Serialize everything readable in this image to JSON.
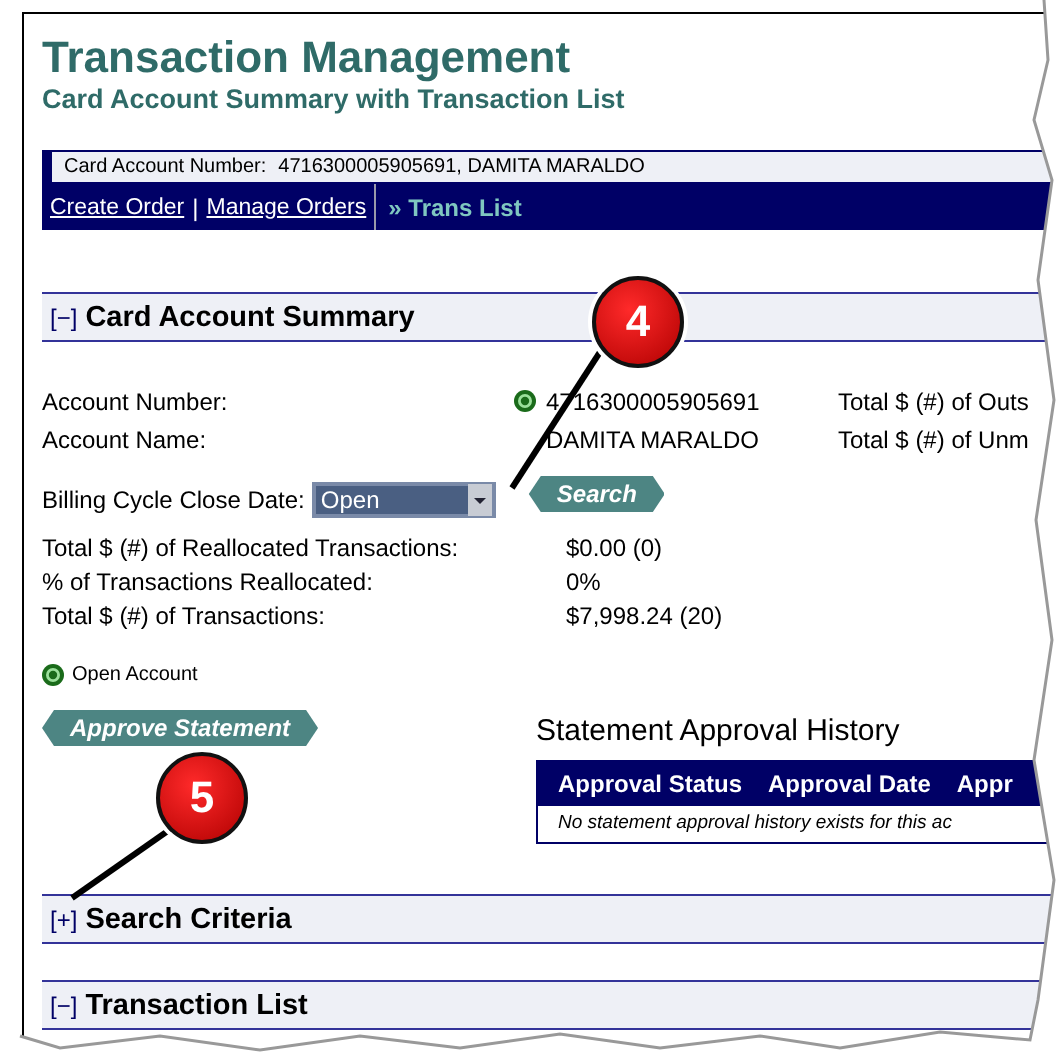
{
  "header": {
    "title": "Transaction Management",
    "subtitle": "Card Account Summary with Transaction List"
  },
  "account_bar": {
    "label": "Card Account Number:",
    "value": "4716300005905691, DAMITA MARALDO"
  },
  "nav": {
    "separator": "|",
    "links": [
      {
        "label": "Create Order"
      },
      {
        "label": "Manage Orders"
      }
    ],
    "current": "» Trans List"
  },
  "summary": {
    "toggle": "[−]",
    "title": "Card Account Summary",
    "fields": [
      {
        "label": "Account Number:",
        "value": "4716300005905691",
        "status_icon": true,
        "extra": "Total $ (#) of Outs"
      },
      {
        "label": "Account Name:",
        "value": "DAMITA MARALDO",
        "status_icon": false,
        "extra": "Total $ (#) of Unm"
      }
    ],
    "billing": {
      "label": "Billing Cycle Close Date:",
      "value": "Open",
      "button": "Search"
    },
    "totals": [
      {
        "label": "Total $ (#) of Reallocated Transactions:",
        "value": "$0.00 (0)"
      },
      {
        "label": "% of Transactions Reallocated:",
        "value": "0%"
      },
      {
        "label": "Total $ (#) of Transactions:",
        "value": "$7,998.24 (20)"
      }
    ],
    "legend": "Open Account",
    "approve_button": "Approve Statement",
    "history": {
      "title": "Statement Approval History",
      "columns": [
        "Approval Status",
        "Approval Date",
        "Appr"
      ],
      "empty": "No statement approval history exists for this ac"
    }
  },
  "sections": [
    {
      "toggle": "[+]",
      "title": "Search Criteria"
    },
    {
      "toggle": "[−]",
      "title": "Transaction List"
    }
  ],
  "callouts": [
    {
      "number": "4"
    },
    {
      "number": "5"
    }
  ]
}
